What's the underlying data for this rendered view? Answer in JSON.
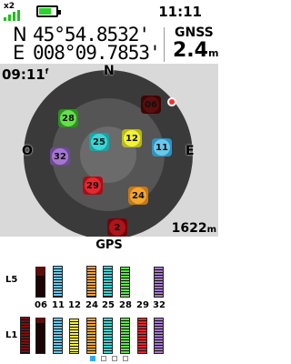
{
  "status": {
    "multiplier": "x2",
    "signal_bars": 4,
    "battery_level": 0.7,
    "time": "11:11"
  },
  "coords": {
    "lat_hemisphere": "N",
    "lat_value": "45°54.8532'",
    "lon_hemisphere": "E",
    "lon_value": "008°09.7853'",
    "source": "GNSS",
    "accuracy_value": "2.4",
    "accuracy_unit": "m"
  },
  "sky": {
    "time": "09:11",
    "time_suffix": "f",
    "elevation_value": "1622",
    "elevation_unit": "m",
    "north": "N",
    "west": "O",
    "east": "E",
    "satellites": [
      {
        "id": "06",
        "color": "#5a0e0e",
        "box": "#3b0606"
      },
      {
        "id": "28",
        "color": "#64e04a",
        "box": "#2f8d22"
      },
      {
        "id": "25",
        "color": "#3cd6d6",
        "box": "#1aa2a2"
      },
      {
        "id": "12",
        "color": "#f2f23a",
        "box": "#b8b81c"
      },
      {
        "id": "11",
        "color": "#68c8ee",
        "box": "#2e93c0"
      },
      {
        "id": "32",
        "color": "#a577d0",
        "box": "#6d4a92"
      },
      {
        "id": "29",
        "color": "#e8262f",
        "box": "#a60f16"
      },
      {
        "id": "24",
        "color": "#f7a52d",
        "box": "#c5761a"
      },
      {
        "id": "2",
        "color": "#b0131a",
        "box": "#6e070c"
      }
    ]
  },
  "signal": {
    "constellation": "GPS",
    "l5_label": "L5",
    "l1_label": "L1",
    "ids": [
      "06",
      "11",
      "12",
      "24",
      "25",
      "28",
      "29",
      "32"
    ],
    "colors": [
      "#5a0e0e",
      "#68c8ee",
      "#f2f23a",
      "#f7a52d",
      "#3cd6d6",
      "#64e04a",
      "#e8262f",
      "#a577d0"
    ],
    "l5_levels": [
      0.78,
      0.8,
      0,
      0.8,
      0.8,
      0.78,
      0,
      0.78
    ],
    "l1_levels": [
      0.88,
      0.88,
      0.84,
      0.88,
      0.88,
      0.88,
      0.88,
      0.88
    ],
    "page_count": 4,
    "active_page": 0
  }
}
